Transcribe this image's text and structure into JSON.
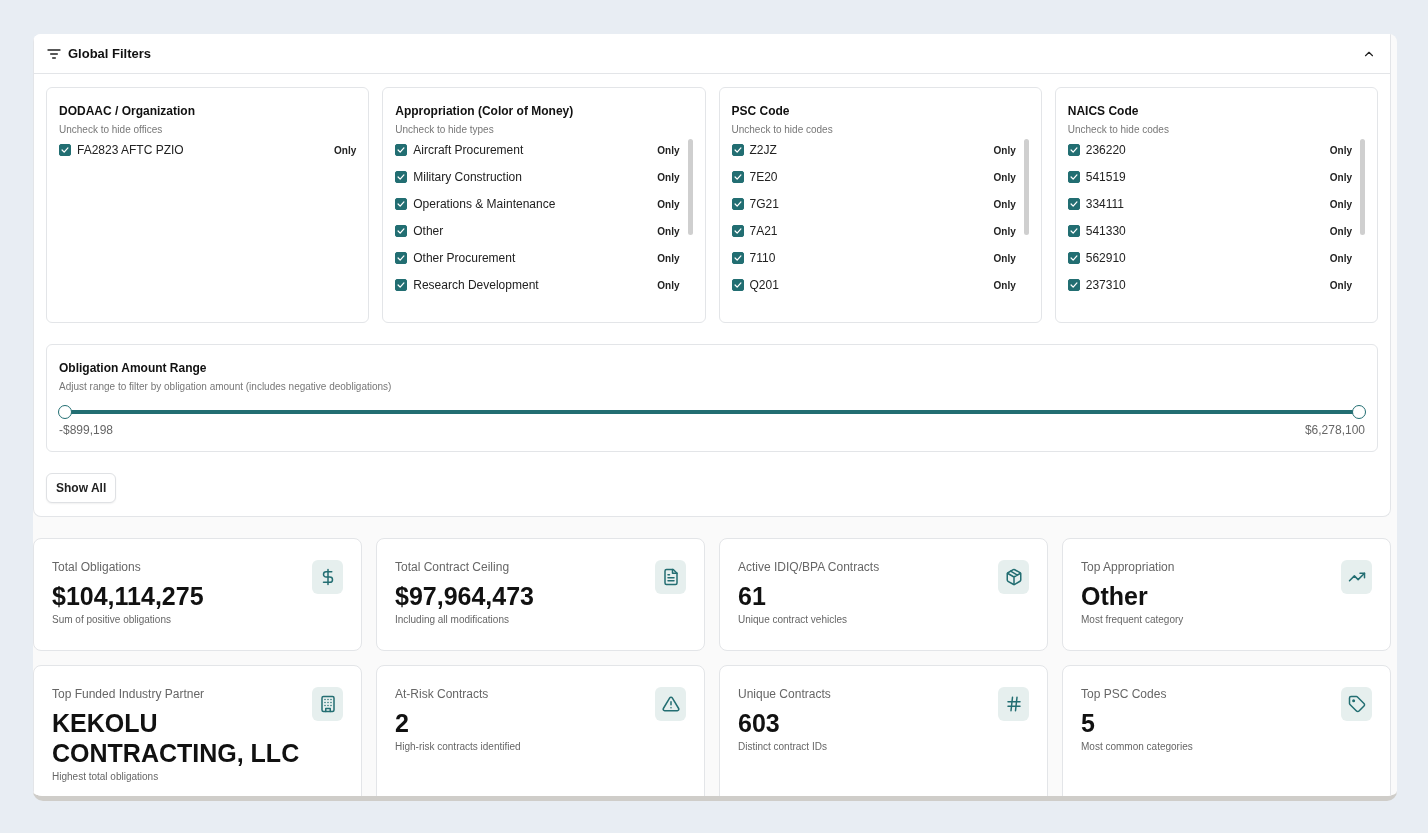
{
  "filters": {
    "title": "Global Filters",
    "expanded": true,
    "lists": [
      {
        "title": "DODAAC / Organization",
        "subtitle": "Uncheck to hide offices",
        "scrollable": false,
        "items": [
          {
            "label": "FA2823 AFTC PZIO",
            "checked": true,
            "action": "Only"
          }
        ]
      },
      {
        "title": "Appropriation (Color of Money)",
        "subtitle": "Uncheck to hide types",
        "scrollable": true,
        "items": [
          {
            "label": "Aircraft Procurement",
            "checked": true,
            "action": "Only"
          },
          {
            "label": "Military Construction",
            "checked": true,
            "action": "Only"
          },
          {
            "label": "Operations & Maintenance",
            "checked": true,
            "action": "Only"
          },
          {
            "label": "Other",
            "checked": true,
            "action": "Only"
          },
          {
            "label": "Other Procurement",
            "checked": true,
            "action": "Only"
          },
          {
            "label": "Research Development",
            "checked": true,
            "action": "Only"
          }
        ]
      },
      {
        "title": "PSC Code",
        "subtitle": "Uncheck to hide codes",
        "scrollable": true,
        "items": [
          {
            "label": "Z2JZ",
            "checked": true,
            "action": "Only"
          },
          {
            "label": "7E20",
            "checked": true,
            "action": "Only"
          },
          {
            "label": "7G21",
            "checked": true,
            "action": "Only"
          },
          {
            "label": "7A21",
            "checked": true,
            "action": "Only"
          },
          {
            "label": "7110",
            "checked": true,
            "action": "Only"
          },
          {
            "label": "Q201",
            "checked": true,
            "action": "Only"
          }
        ]
      },
      {
        "title": "NAICS Code",
        "subtitle": "Uncheck to hide codes",
        "scrollable": true,
        "items": [
          {
            "label": "236220",
            "checked": true,
            "action": "Only"
          },
          {
            "label": "541519",
            "checked": true,
            "action": "Only"
          },
          {
            "label": "334111",
            "checked": true,
            "action": "Only"
          },
          {
            "label": "541330",
            "checked": true,
            "action": "Only"
          },
          {
            "label": "562910",
            "checked": true,
            "action": "Only"
          },
          {
            "label": "237310",
            "checked": true,
            "action": "Only"
          }
        ]
      }
    ],
    "range": {
      "title": "Obligation Amount Range",
      "subtitle": "Adjust range to filter by obligation amount (includes negative deobligations)",
      "thumbs": [
        {
          "level": 0
        },
        {
          "level": 1
        }
      ],
      "min_label": "-$899,198",
      "max_label": "$6,278,100"
    },
    "reset_button": "Show All"
  },
  "stats": [
    {
      "label": "Total Obligations",
      "value": "$104,114,275",
      "note": "Sum of positive obligations",
      "kind": "dollar"
    },
    {
      "label": "Total Contract Ceiling",
      "value": "$97,964,473",
      "note": "Including all modifications",
      "kind": "document"
    },
    {
      "label": "Active IDIQ/BPA Contracts",
      "value": "61",
      "note": "Unique contract vehicles",
      "kind": "box"
    },
    {
      "label": "Top Appropriation",
      "value": "Other",
      "note": "Most frequent category",
      "kind": "trend"
    },
    {
      "label": "Top Funded Industry Partner",
      "value": "KEKOLU CONTRACTING, LLC",
      "note": "Highest total obligations",
      "kind": "building"
    },
    {
      "label": "At-Risk Contracts",
      "value": "2",
      "note": "High-risk contracts identified",
      "kind": "warning"
    },
    {
      "label": "Unique Contracts",
      "value": "603",
      "note": "Distinct contract IDs",
      "kind": "hash"
    },
    {
      "label": "Top PSC Codes",
      "value": "5",
      "note": "Most common categories",
      "kind": "tag"
    }
  ]
}
